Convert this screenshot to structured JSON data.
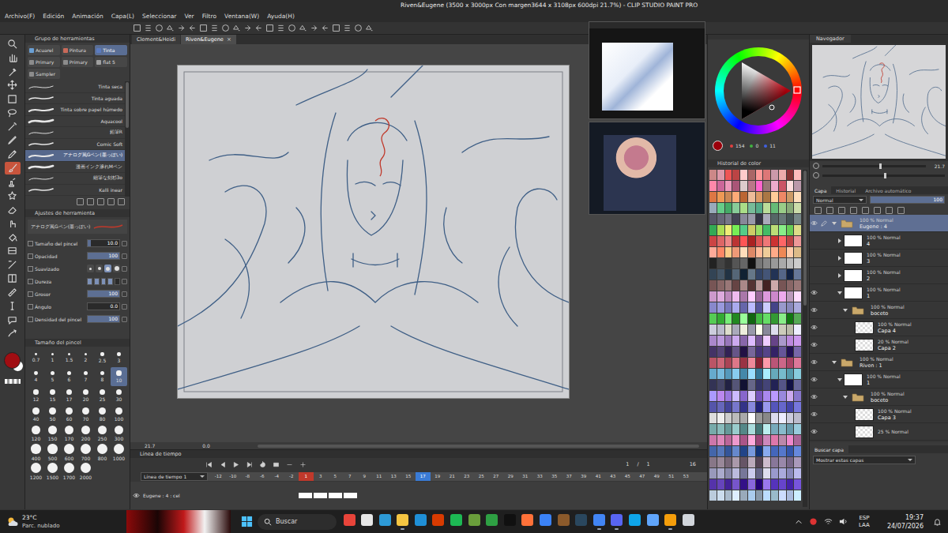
{
  "window": {
    "title": "Riven&Eugene (3500 x 3000px Con margen3644 x 3108px 600dpi 21.7%) - CLIP STUDIO PAINT PRO"
  },
  "menu": [
    "Archivo(F)",
    "Edición",
    "Animación",
    "Capa(L)",
    "Seleccionar",
    "Ver",
    "Filtro",
    "Ventana(W)",
    "Ayuda(H)"
  ],
  "document_tabs": {
    "close": "×",
    "items": [
      {
        "label": "Clement&Heidi",
        "selected": false
      },
      {
        "label": "Riven&Eugene",
        "selected": true
      }
    ]
  },
  "tools": [
    {
      "selected": false
    },
    {
      "selected": false
    },
    {
      "selected": false
    },
    {
      "selected": false
    },
    {
      "selected": false
    },
    {
      "selected": false
    },
    {
      "selected": false
    },
    {
      "selected": false
    },
    {
      "selected": false
    },
    {
      "selected": true
    },
    {
      "selected": false
    },
    {
      "selected": false
    },
    {
      "selected": false
    },
    {
      "selected": false
    },
    {
      "selected": false
    },
    {
      "selected": false
    },
    {
      "selected": false
    },
    {
      "selected": false
    },
    {
      "selected": false
    },
    {
      "selected": false
    },
    {
      "selected": false
    },
    {
      "selected": false
    }
  ],
  "colors": {
    "main": "#a00d12",
    "sub": "#ffffff"
  },
  "tool_group": {
    "title": "Grupo de herramientas",
    "tabs": [
      {
        "label": "Acuarel",
        "selected": false
      },
      {
        "label": "Pintura",
        "selected": false
      },
      {
        "label": "Tinta",
        "selected": true
      },
      {
        "label": "Primary",
        "selected": false
      },
      {
        "label": "Primary",
        "selected": false
      },
      {
        "label": "flat 5",
        "selected": false
      },
      {
        "label": "Sampler",
        "selected": false
      }
    ]
  },
  "brushes": [
    {
      "name": "Tinta seca",
      "selected": false
    },
    {
      "name": "Tinta aguada",
      "selected": false
    },
    {
      "name": "Tinta sobre papel húmedo",
      "selected": false
    },
    {
      "name": "Aquacool",
      "selected": false
    },
    {
      "name": "鉛筆R",
      "selected": false
    },
    {
      "name": "Comic Soft",
      "selected": false
    },
    {
      "name": "アナログ風Gペン(墨っぽい)",
      "selected": true
    },
    {
      "name": "漫画インク滲れMペン",
      "selected": false
    },
    {
      "name": "細筆な刻杉3o",
      "selected": false
    },
    {
      "name": "Kalli inear",
      "selected": false
    }
  ],
  "tool_settings": {
    "title": "Ajustes de herramienta",
    "brush": "アナログ風Gペン(墨っぽい)",
    "properties": [
      {
        "kind": "slider",
        "label": "Tamaño del pincel",
        "value": "10.0",
        "level": 0.1
      },
      {
        "kind": "slider",
        "label": "Opacidad",
        "value": "100",
        "level": 1
      },
      {
        "kind": "choice",
        "label": "Suavizado",
        "options": [
          {
            "selected": false
          },
          {
            "selected": false
          },
          {
            "selected": true
          },
          {
            "selected": false
          }
        ]
      },
      {
        "kind": "steps",
        "label": "Dureza",
        "options": [
          {
            "filled": true
          },
          {
            "filled": true
          },
          {
            "filled": true
          },
          {
            "filled": true
          },
          {
            "filled": false
          }
        ]
      },
      {
        "kind": "slider",
        "label": "Grosor",
        "value": "100",
        "level": 1
      },
      {
        "kind": "slider",
        "label": "Ángulo",
        "value": "0.0",
        "level": 0
      },
      {
        "kind": "slider",
        "label": "Densidad del pincel",
        "value": "100",
        "level": 1
      }
    ]
  },
  "brush_size": {
    "title": "Tamaño del pincel",
    "sizes": [
      {
        "label": "0.7",
        "selected": false
      },
      {
        "label": "1",
        "selected": false
      },
      {
        "label": "1.5",
        "selected": false
      },
      {
        "label": "2",
        "selected": false
      },
      {
        "label": "2.5",
        "selected": false
      },
      {
        "label": "3",
        "selected": false
      },
      {
        "label": "4",
        "selected": false
      },
      {
        "label": "5",
        "selected": false
      },
      {
        "label": "6",
        "selected": false
      },
      {
        "label": "7",
        "selected": false
      },
      {
        "label": "8",
        "selected": false
      },
      {
        "label": "10",
        "selected": true
      },
      {
        "label": "12",
        "selected": false
      },
      {
        "label": "15",
        "selected": false
      },
      {
        "label": "17",
        "selected": false
      },
      {
        "label": "20",
        "selected": false
      },
      {
        "label": "25",
        "selected": false
      },
      {
        "label": "30",
        "selected": false
      },
      {
        "label": "40",
        "selected": false
      },
      {
        "label": "50",
        "selected": false
      },
      {
        "label": "60",
        "selected": false
      },
      {
        "label": "70",
        "selected": false
      },
      {
        "label": "80",
        "selected": false
      },
      {
        "label": "100",
        "selected": false
      },
      {
        "label": "120",
        "selected": false
      },
      {
        "label": "150",
        "selected": false
      },
      {
        "label": "170",
        "selected": false
      },
      {
        "label": "200",
        "selected": false
      },
      {
        "label": "250",
        "selected": false
      },
      {
        "label": "300",
        "selected": false
      },
      {
        "label": "400",
        "selected": false
      },
      {
        "label": "500",
        "selected": false
      },
      {
        "label": "600",
        "selected": false
      },
      {
        "label": "700",
        "selected": false
      },
      {
        "label": "800",
        "selected": false
      },
      {
        "label": "1000",
        "selected": false
      },
      {
        "label": "1200",
        "selected": false
      },
      {
        "label": "1500",
        "selected": false
      },
      {
        "label": "1700",
        "selected": false
      },
      {
        "label": "2000",
        "selected": false
      }
    ]
  },
  "canvas": {
    "zoom": "21.7",
    "rotation": "0.0"
  },
  "timeline": {
    "title": "Línea de tiempo",
    "name": "Línea de tiempo 1",
    "frame": "1",
    "separator": "/",
    "frame_total": "1",
    "end": "16",
    "frames": [
      {
        "label": "-12",
        "marker": "none"
      },
      {
        "label": "-10",
        "marker": "none"
      },
      {
        "label": "-8",
        "marker": "none"
      },
      {
        "label": "-6",
        "marker": "none"
      },
      {
        "label": "-4",
        "marker": "none"
      },
      {
        "label": "-2",
        "marker": "none"
      },
      {
        "label": "1",
        "marker": "start"
      },
      {
        "label": "3",
        "marker": "none"
      },
      {
        "label": "5",
        "marker": "none"
      },
      {
        "label": "7",
        "marker": "none"
      },
      {
        "label": "9",
        "marker": "none"
      },
      {
        "label": "11",
        "marker": "none"
      },
      {
        "label": "13",
        "marker": "none"
      },
      {
        "label": "15",
        "marker": "none"
      },
      {
        "label": "17",
        "marker": "end"
      },
      {
        "label": "19",
        "marker": "none"
      },
      {
        "label": "21",
        "marker": "none"
      },
      {
        "label": "23",
        "marker": "none"
      },
      {
        "label": "25",
        "marker": "none"
      },
      {
        "label": "27",
        "marker": "none"
      },
      {
        "label": "29",
        "marker": "none"
      },
      {
        "label": "31",
        "marker": "none"
      },
      {
        "label": "33",
        "marker": "none"
      },
      {
        "label": "35",
        "marker": "none"
      },
      {
        "label": "37",
        "marker": "none"
      },
      {
        "label": "39",
        "marker": "none"
      },
      {
        "label": "41",
        "marker": "none"
      },
      {
        "label": "43",
        "marker": "none"
      },
      {
        "label": "45",
        "marker": "none"
      },
      {
        "label": "47",
        "marker": "none"
      },
      {
        "label": "49",
        "marker": "none"
      },
      {
        "label": "51",
        "marker": "none"
      },
      {
        "label": "53",
        "marker": "none"
      }
    ],
    "track": {
      "name": "Eugene : 4 : cel",
      "visible": true,
      "cels": [
        {
          "filled": true
        },
        {
          "filled": true
        },
        {
          "filled": true
        },
        {
          "filled": true
        }
      ]
    }
  },
  "color_wheel": {
    "color": "#9a000b",
    "hue_color": "#ff0012",
    "values": [
      "154",
      "0",
      "11"
    ]
  },
  "color_history": {
    "title": "Historial de color",
    "colors": [
      "#c88",
      "#d9a",
      "#e55",
      "#b44",
      "#fcc",
      "#a66",
      "#f99",
      "#d77",
      "#c9a",
      "#eaa",
      "#833",
      "#fbb",
      "#f8a",
      "#c69",
      "#e9b",
      "#a57",
      "#dcc",
      "#b78",
      "#f6c",
      "#977",
      "#eac",
      "#c56",
      "#fdd",
      "#b9a",
      "#d74",
      "#e95",
      "#c85",
      "#fa7",
      "#b63",
      "#eb9",
      "#d96",
      "#a74",
      "#fc9",
      "#e86",
      "#c96",
      "#fdb",
      "#9ab",
      "#6c8",
      "#4a6",
      "#8c9",
      "#ad8",
      "#7b9",
      "#5a8",
      "#bd9",
      "#6b7",
      "#9c8",
      "#8a7",
      "#cda",
      "#556",
      "#667",
      "#778",
      "#445",
      "#889",
      "#99a",
      "#334",
      "#aab",
      "#566",
      "#677",
      "#455",
      "#788",
      "#3a5",
      "#ad5",
      "#ee7",
      "#7e5",
      "#5c8",
      "#cc6",
      "#9d6",
      "#4b6",
      "#bd7",
      "#8e8",
      "#6c5",
      "#dd8",
      "#c44",
      "#d66",
      "#e88",
      "#b33",
      "#f55",
      "#a22",
      "#d55",
      "#e77",
      "#c33",
      "#f66",
      "#b44",
      "#e99",
      "#fa9",
      "#f86",
      "#fc8",
      "#e97",
      "#fdb",
      "#d86",
      "#fb9",
      "#ec9",
      "#fa8",
      "#e85",
      "#fca",
      "#db8",
      "#222",
      "#444",
      "#333",
      "#555",
      "#666",
      "#111",
      "#777",
      "#888",
      "#999",
      "#aaa",
      "#bbb",
      "#ccc",
      "#345",
      "#456",
      "#234",
      "#567",
      "#123",
      "#678",
      "#346",
      "#457",
      "#235",
      "#568",
      "#124",
      "#679",
      "#755",
      "#866",
      "#977",
      "#644",
      "#a88",
      "#533",
      "#b99",
      "#422",
      "#caa",
      "#755",
      "#866",
      "#977",
      "#c9c",
      "#dad",
      "#b8b",
      "#ebe",
      "#a7a",
      "#fcf",
      "#969",
      "#d9d",
      "#c8c",
      "#eae",
      "#b9b",
      "#fdf",
      "#88c",
      "#99d",
      "#77b",
      "#aae",
      "#66a",
      "#bbf",
      "#559",
      "#ccf",
      "#448",
      "#99c",
      "#88b",
      "#aad",
      "#5c5",
      "#3a3",
      "#7e7",
      "#282",
      "#9f9",
      "#161",
      "#4b4",
      "#6d6",
      "#393",
      "#8e8",
      "#171",
      "#5a5",
      "#ccd",
      "#bbc",
      "#ddc",
      "#aab",
      "#eed",
      "#99a",
      "#ffe",
      "#889",
      "#dde",
      "#ccb",
      "#bba",
      "#eef",
      "#a8c",
      "#b9d",
      "#97b",
      "#cae",
      "#86a",
      "#dbf",
      "#759",
      "#ecf",
      "#648",
      "#a9c",
      "#b8d",
      "#c9e",
      "#436",
      "#547",
      "#325",
      "#658",
      "#214",
      "#769",
      "#437",
      "#548",
      "#326",
      "#659",
      "#215",
      "#76a",
      "#b56",
      "#c67",
      "#a45",
      "#d78",
      "#934",
      "#e89",
      "#823",
      "#f9a",
      "#b57",
      "#c68",
      "#a46",
      "#d79",
      "#6ac",
      "#7bd",
      "#59b",
      "#8ce",
      "#48a",
      "#9df",
      "#379",
      "#aef",
      "#6ab",
      "#7bc",
      "#59a",
      "#8cd",
      "#335",
      "#446",
      "#224",
      "#557",
      "#113",
      "#668",
      "#336",
      "#447",
      "#225",
      "#558",
      "#114",
      "#669",
      "#a9f",
      "#b8e",
      "#97d",
      "#cbf",
      "#86c",
      "#dcf",
      "#75b",
      "#a8e",
      "#b9f",
      "#98d",
      "#cae",
      "#87c",
      "#55a",
      "#66b",
      "#449",
      "#77c",
      "#338",
      "#88d",
      "#227",
      "#99e",
      "#55b",
      "#66c",
      "#44a",
      "#77d",
      "#ddd",
      "#eee",
      "#ccc",
      "#bbb",
      "#aaa",
      "#fff",
      "#999",
      "#888",
      "#dde",
      "#eef",
      "#ccd",
      "#bbc",
      "#7aa",
      "#8bb",
      "#699",
      "#9cc",
      "#588",
      "#add",
      "#477",
      "#bee",
      "#7ab",
      "#8bc",
      "#69a",
      "#9cd",
      "#c7a",
      "#d8b",
      "#b69",
      "#e9c",
      "#a58",
      "#fad",
      "#947",
      "#c8b",
      "#d7a",
      "#b8a",
      "#e8c",
      "#a69",
      "#46a",
      "#57b",
      "#359",
      "#68c",
      "#248",
      "#79d",
      "#137",
      "#8ae",
      "#46b",
      "#57c",
      "#35a",
      "#68d",
      "#878",
      "#989",
      "#767",
      "#a9a",
      "#656",
      "#bab",
      "#545",
      "#cbc",
      "#879",
      "#98a",
      "#768",
      "#a9b",
      "#99b",
      "#aac",
      "#88a",
      "#bbd",
      "#779",
      "#cce",
      "#668",
      "#dde",
      "#99c",
      "#aad",
      "#88b",
      "#bbe",
      "#53a",
      "#64b",
      "#429",
      "#75c",
      "#318",
      "#86d",
      "#207",
      "#97e",
      "#53b",
      "#64c",
      "#42a",
      "#75d",
      "#bcd",
      "#cde",
      "#abc",
      "#def",
      "#9ab",
      "#ace",
      "#89a",
      "#bdf",
      "#9bc",
      "#cdf",
      "#abd",
      "#cef"
    ]
  },
  "navigator": {
    "title": "Navegador",
    "zoom": "21.7",
    "zoom_level": 0.55,
    "rotation_level": 0.5
  },
  "layers": {
    "tabs": [
      {
        "label": "Capa",
        "selected": true
      },
      {
        "label": "Historial",
        "selected": false
      },
      {
        "label": "Archivo automático",
        "selected": false
      }
    ],
    "blend": "Normal",
    "opacity": "100",
    "items": [
      {
        "blend": "100 % Normal",
        "name": "Eugene : 4",
        "kind": "folder",
        "depth": 0,
        "expanded": true,
        "selected": true,
        "visible": true
      },
      {
        "blend": "100 % Normal",
        "name": "4",
        "kind": "cel",
        "depth": 1,
        "expanded": false,
        "selected": false,
        "visible": false
      },
      {
        "blend": "100 % Normal",
        "name": "3",
        "kind": "cel",
        "depth": 1,
        "expanded": false,
        "selected": false,
        "visible": false
      },
      {
        "blend": "100 % Normal",
        "name": "2",
        "kind": "cel",
        "depth": 1,
        "expanded": false,
        "selected": false,
        "visible": false
      },
      {
        "blend": "100 % Normal",
        "name": "1",
        "kind": "cel",
        "depth": 1,
        "expanded": true,
        "selected": false,
        "visible": true
      },
      {
        "blend": "100 % Normal",
        "name": "boceto",
        "kind": "folder",
        "depth": 2,
        "expanded": true,
        "selected": false,
        "visible": true
      },
      {
        "blend": "100 % Normal",
        "name": "Capa 4",
        "kind": "layer",
        "depth": 3,
        "expanded": false,
        "selected": false,
        "visible": true
      },
      {
        "blend": "20 % Normal",
        "name": "Capa 2",
        "kind": "layer",
        "depth": 3,
        "expanded": false,
        "selected": false,
        "visible": true
      },
      {
        "blend": "100 % Normal",
        "name": "Riven : 1",
        "kind": "folder",
        "depth": 0,
        "expanded": true,
        "selected": false,
        "visible": true
      },
      {
        "blend": "100 % Normal",
        "name": "1",
        "kind": "cel",
        "depth": 1,
        "expanded": true,
        "selected": false,
        "visible": true
      },
      {
        "blend": "100 % Normal",
        "name": "boceto",
        "kind": "folder",
        "depth": 2,
        "expanded": true,
        "selected": false,
        "visible": true
      },
      {
        "blend": "100 % Normal",
        "name": "Capa 3",
        "kind": "layer",
        "depth": 3,
        "expanded": false,
        "selected": false,
        "visible": true
      },
      {
        "blend": "25 % Normal",
        "kind": "layer",
        "depth": 3,
        "expanded": false,
        "selected": false,
        "visible": true
      }
    ]
  },
  "layer_search": {
    "tab": "Buscar capa",
    "filter": "Mostrar estas capas"
  },
  "taskbar": {
    "weather": {
      "temp": "23°C",
      "text": "Parc. nublado"
    },
    "search": "Buscar",
    "apps": [
      {
        "running": false
      },
      {
        "running": false
      },
      {
        "running": false
      },
      {
        "running": true
      },
      {
        "running": false
      },
      {
        "running": false
      },
      {
        "running": false
      },
      {
        "running": false
      },
      {
        "running": false
      },
      {
        "running": false
      },
      {
        "running": false
      },
      {
        "running": false
      },
      {
        "running": false
      },
      {
        "running": false
      },
      {
        "running": true
      },
      {
        "running": true
      },
      {
        "running": false
      },
      {
        "running": false
      },
      {
        "running": true
      },
      {
        "running": false
      }
    ],
    "language": "ESP",
    "layout": "LAA",
    "time": "19:37",
    "date": "24/07/2026"
  }
}
